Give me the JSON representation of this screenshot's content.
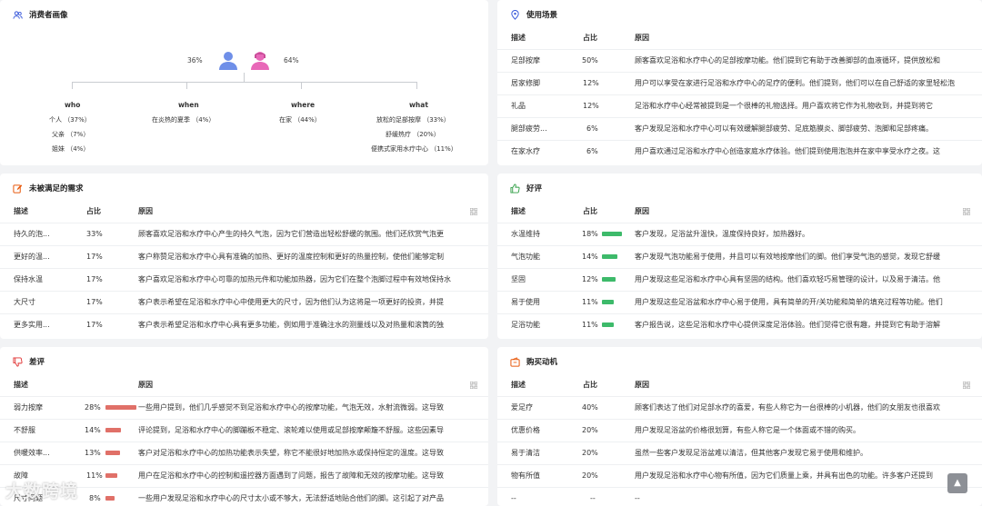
{
  "colors": {
    "green": "#3dba6a",
    "red": "#e07068",
    "accent": "#3b5bdb"
  },
  "persona": {
    "title": "消费者画像",
    "male_pct": "36%",
    "female_pct": "64%",
    "who": {
      "head": "who",
      "items": [
        "个人 （37%）",
        "父亲 （7%）",
        "姐妹 （4%）"
      ]
    },
    "when": {
      "head": "when",
      "items": [
        "在炎热的夏季 （4%）"
      ]
    },
    "where": {
      "head": "where",
      "items": [
        "在家 （44%）"
      ]
    },
    "what": {
      "head": "what",
      "items": [
        "放松的足部按摩 （33%）",
        "舒缓热疗 （20%）",
        "便携式家用水疗中心 （11%）"
      ]
    }
  },
  "scenes": {
    "title": "使用场景",
    "headers": [
      "描述",
      "占比",
      "原因"
    ],
    "rows": [
      [
        "足部按摩",
        "50%",
        "顾客喜欢足浴和水疗中心的足部按摩功能。他们提到它有助于改善脚部的血液循环，提供放松和"
      ],
      [
        "居家修脚",
        "12%",
        "用户可以享受在家进行足浴和水疗中心的足疗的便利。他们提到，他们可以在自己舒适的家里轻松泡"
      ],
      [
        "礼品",
        "12%",
        "足浴和水疗中心经常被提到是一个很棒的礼物选择。用户喜欢将它作为礼物收到，并提到将它"
      ],
      [
        "腿部疲劳...",
        "6%",
        "客户发现足浴和水疗中心可以有效缓解腿部疲劳、足底筋膜炎、脚部疲劳、泡脚和足部疼痛。"
      ],
      [
        "在家水疗",
        "6%",
        "用户喜欢通过足浴和水疗中心创造家庭水疗体验。他们提到使用泡泡并在家中享受水疗之夜。这"
      ]
    ]
  },
  "unmet": {
    "title": "未被满足的需求",
    "headers": [
      "描述",
      "占比",
      "原因"
    ],
    "rows": [
      [
        "持久的泡...",
        "33%",
        "顾客喜欢足浴和水疗中心产生的持久气泡，因为它们营造出轻松舒缓的氛围。他们还欣赏气泡更"
      ],
      [
        "更好的温...",
        "17%",
        "客户称赞足浴和水疗中心具有准确的加热、更好的温度控制和更好的热量控制，使他们能够定制"
      ],
      [
        "保持水温",
        "17%",
        "客户喜欢足浴和水疗中心可靠的加热元件和功能加热器，因为它们在整个泡脚过程中有效地保持水"
      ],
      [
        "大尺寸",
        "17%",
        "客户表示希望在足浴和水疗中心中使用更大的尺寸，因为他们认为这将是一项更好的投资，并提"
      ],
      [
        "更多实用...",
        "17%",
        "客户表示希望足浴和水疗中心具有更多功能，例如用于准确注水的测量线以及对热量和滚筒的独"
      ]
    ]
  },
  "positive": {
    "title": "好评",
    "headers": [
      "描述",
      "占比",
      "原因"
    ],
    "rows": [
      {
        "desc": "水温维持",
        "pct": "18%",
        "level": 0.18,
        "reason": "客户发现，足浴盆升温快，温度保持良好，加热器好。"
      },
      {
        "desc": "气泡功能",
        "pct": "14%",
        "level": 0.14,
        "reason": "客户发现气泡功能易于使用，并且可以有效地按摩他们的脚。他们享受气泡的感觉，发现它舒缓"
      },
      {
        "desc": "坚固",
        "pct": "12%",
        "level": 0.12,
        "reason": "用户发现这些足浴和水疗中心具有坚固的结构。他们喜欢轻巧易管理的设计，以及易于清洁。他"
      },
      {
        "desc": "易于使用",
        "pct": "11%",
        "level": 0.11,
        "reason": "用户发现这些足浴盆和水疗中心易于使用，具有简单的开/关功能和简单的填充过程等功能。他们"
      },
      {
        "desc": "足浴功能",
        "pct": "11%",
        "level": 0.11,
        "reason": "客户报告说，这些足浴和水疗中心提供深度足浴体验。他们觉得它很有趣，并提到它有助于溶解"
      }
    ]
  },
  "negative": {
    "title": "差评",
    "headers": [
      "描述",
      "原因"
    ],
    "rows": [
      {
        "desc": "弱力按摩",
        "pct": "28%",
        "level": 0.28,
        "reason": "一些用户提到，他们几乎感觉不到足浴和水疗中心的按摩功能，气泡无效，水射流微弱。这导致"
      },
      {
        "desc": "不舒服",
        "pct": "14%",
        "level": 0.14,
        "reason": "评论提到，足浴和水疗中心的脚蹦板不稳定、滚轮难以使用或足部按摩颠簸不舒服。这些因素导"
      },
      {
        "desc": "供暖效率...",
        "pct": "13%",
        "level": 0.13,
        "reason": "客户对足浴和水疗中心的加热功能表示失望，称它不能很好地加热水或保持恒定的温度。这导致"
      },
      {
        "desc": "故障",
        "pct": "11%",
        "level": 0.11,
        "reason": "用户在足浴和水疗中心的控制和遥控器方面遇到了问题，报告了故障和无效的按摩功能。这导致"
      },
      {
        "desc": "尺寸问题",
        "pct": "8%",
        "level": 0.08,
        "reason": "一些用户发现足浴和水疗中心的尺寸太小或不够大，无法舒适地贴合他们的脚。这引起了对产品"
      }
    ]
  },
  "motivation": {
    "title": "购买动机",
    "headers": [
      "描述",
      "占比",
      "原因"
    ],
    "rows": [
      [
        "爱足疗",
        "40%",
        "顾客们表达了他们对足部水疗的喜爱，有些人称它为一台很棒的小机器，他们的女朋友也很喜欢"
      ],
      [
        "优惠价格",
        "20%",
        "用户发现足浴盆的价格很划算，有些人称它是一个体面或不错的购买。"
      ],
      [
        "易于清洁",
        "20%",
        "虽然一些客户发现足浴盆难以清洁，但其他客户发现它易于使用和维护。"
      ],
      [
        "物有所值",
        "20%",
        "用户发现足浴和水疗中心物有所值，因为它们质量上乘，并具有出色的功能。许多客户还提到"
      ],
      [
        "--",
        "--",
        "--"
      ]
    ]
  },
  "watermark": "大数跨境"
}
